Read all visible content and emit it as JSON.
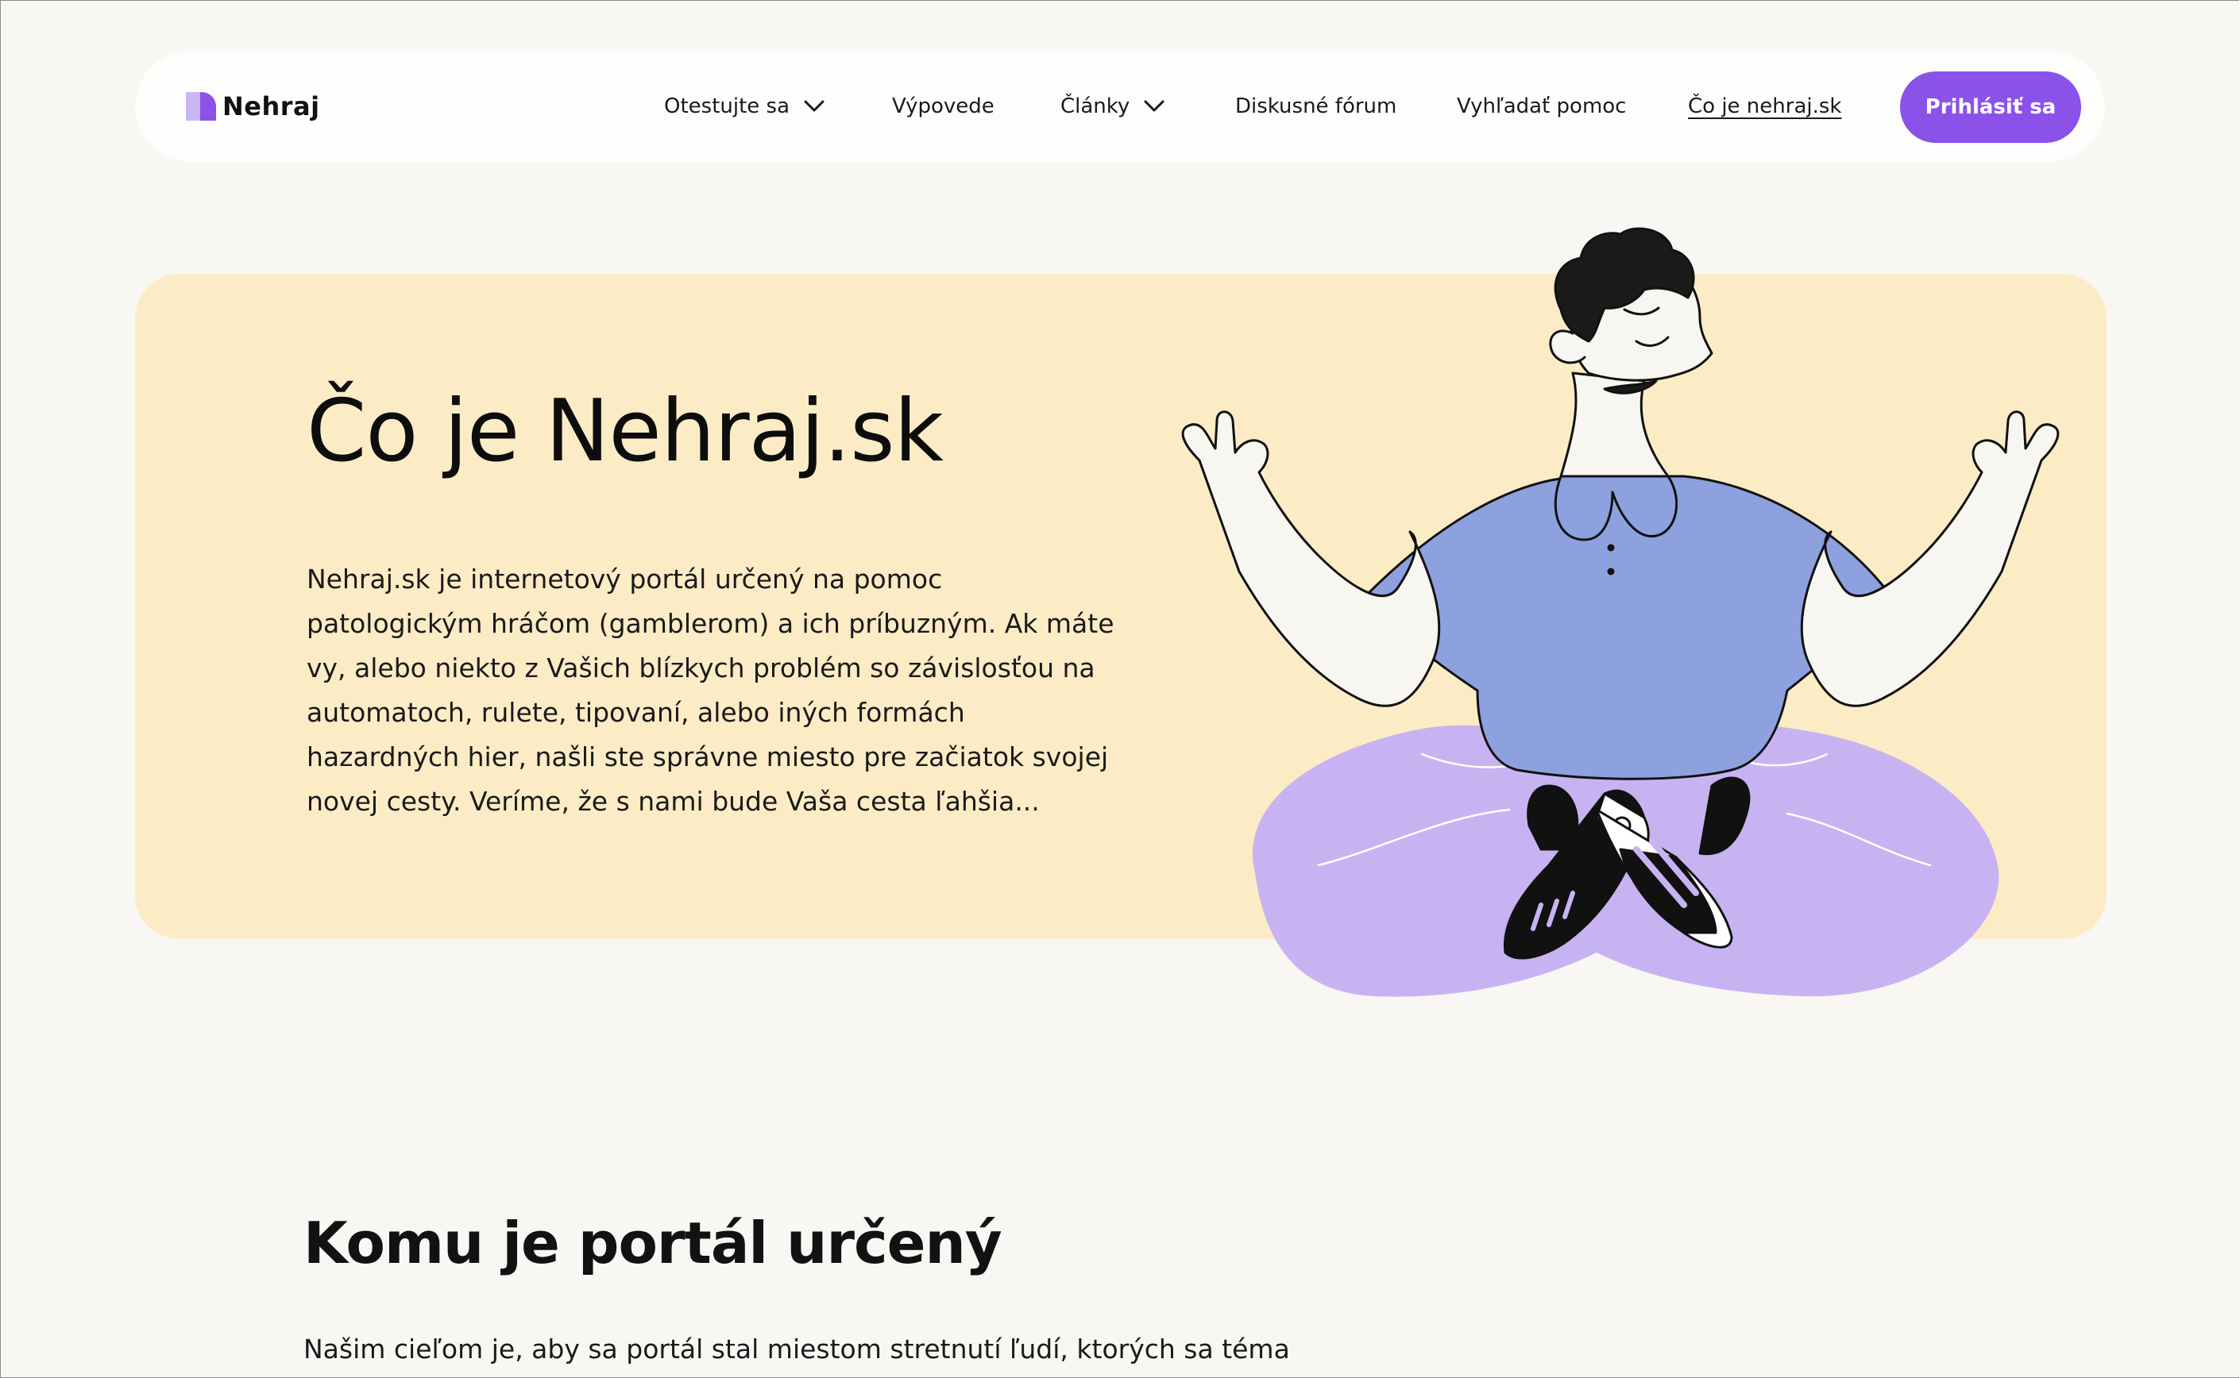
{
  "brand": {
    "name": "Nehraj",
    "accent": "#8b52ea",
    "accent_light": "#c9b6f3"
  },
  "nav": {
    "items": [
      {
        "label": "Otestujte sa",
        "has_dropdown": true
      },
      {
        "label": "Výpovede",
        "has_dropdown": false
      },
      {
        "label": "Články",
        "has_dropdown": true
      },
      {
        "label": "Diskusné fórum",
        "has_dropdown": false
      },
      {
        "label": "Vyhľadať pomoc",
        "has_dropdown": false
      },
      {
        "label": "Čo je nehraj.sk",
        "has_dropdown": false,
        "active": true
      }
    ],
    "login_label": "Prihlásiť sa",
    "dropdown_icon": "chevron-down-icon"
  },
  "hero": {
    "title": "Čo je Nehraj.sk",
    "text": "Nehraj.sk je internetový portál určený na pomoc\npatologickým hráčom (gamblerom) a ich príbuzným. Ak máte\nvy, alebo niekto z Vašich blízkych problém so závislosťou na\nautomatoch, rulete, tipovaní, alebo iných formách\nhazardných hier, našli ste správne miesto pre začiatok svojej\nnovej cesty. Veríme, že s nami bude Vaša cesta ľahšia...",
    "background": "#fcecc6",
    "illustration": "meditating-person-illustration"
  },
  "section": {
    "title": "Komu je portál určený",
    "text": "Našim cieľom je, aby sa portál stal miestom stretnutí ľudí, ktorých sa téma"
  }
}
